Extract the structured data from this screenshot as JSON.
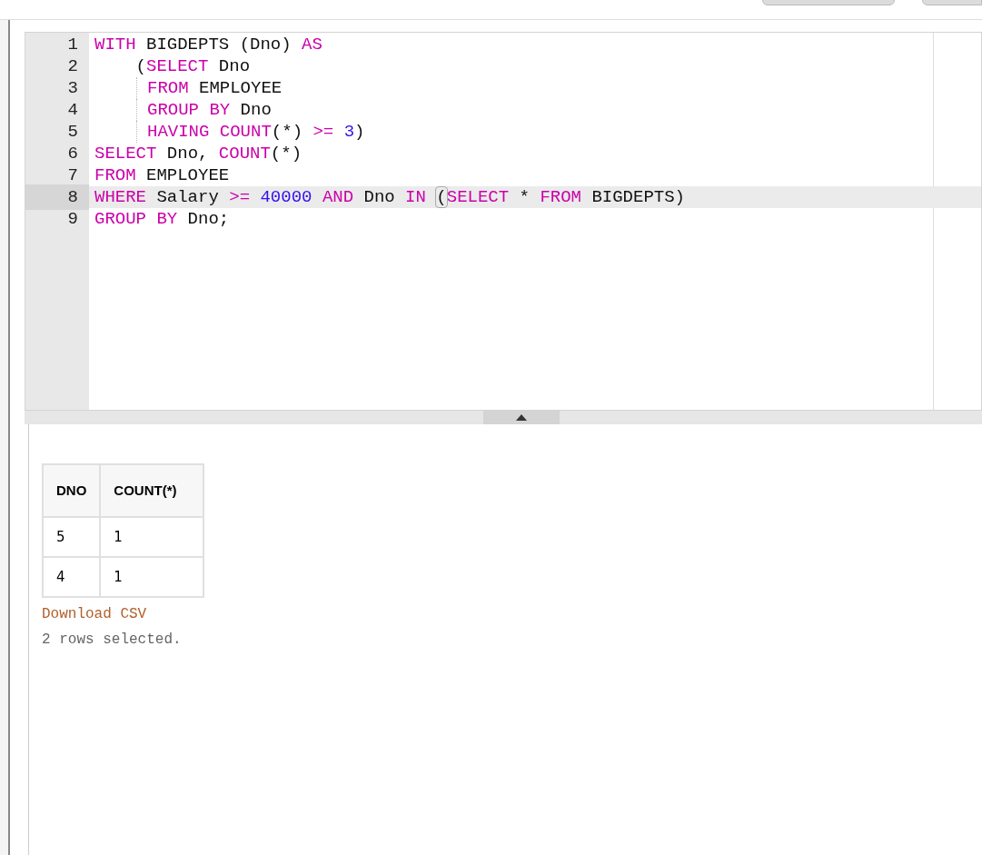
{
  "editor": {
    "lines": [
      {
        "number": "1",
        "active": false,
        "indent_guide": false,
        "tokens": [
          {
            "kind": "keyword",
            "text": "WITH"
          },
          {
            "kind": "plain",
            "text": " BIGDEPTS (Dno) "
          },
          {
            "kind": "keyword",
            "text": "AS"
          }
        ]
      },
      {
        "number": "2",
        "active": false,
        "indent_guide": false,
        "tokens": [
          {
            "kind": "plain",
            "text": "    ("
          },
          {
            "kind": "keyword",
            "text": "SELECT"
          },
          {
            "kind": "plain",
            "text": " Dno"
          }
        ]
      },
      {
        "number": "3",
        "active": false,
        "indent_guide": true,
        "tokens": [
          {
            "kind": "keyword",
            "text": "FROM"
          },
          {
            "kind": "plain",
            "text": " EMPLOYEE"
          }
        ]
      },
      {
        "number": "4",
        "active": false,
        "indent_guide": true,
        "tokens": [
          {
            "kind": "keyword",
            "text": "GROUP BY"
          },
          {
            "kind": "plain",
            "text": " Dno"
          }
        ]
      },
      {
        "number": "5",
        "active": false,
        "indent_guide": true,
        "tokens": [
          {
            "kind": "keyword",
            "text": "HAVING COUNT"
          },
          {
            "kind": "plain",
            "text": "(*) "
          },
          {
            "kind": "keyword",
            "text": ">= "
          },
          {
            "kind": "number",
            "text": "3"
          },
          {
            "kind": "plain",
            "text": ")"
          }
        ]
      },
      {
        "number": "6",
        "active": false,
        "indent_guide": false,
        "tokens": [
          {
            "kind": "keyword",
            "text": "SELECT"
          },
          {
            "kind": "plain",
            "text": " Dno, "
          },
          {
            "kind": "keyword",
            "text": "COUNT"
          },
          {
            "kind": "plain",
            "text": "(*)"
          }
        ]
      },
      {
        "number": "7",
        "active": false,
        "indent_guide": false,
        "tokens": [
          {
            "kind": "keyword",
            "text": "FROM"
          },
          {
            "kind": "plain",
            "text": " EMPLOYEE"
          }
        ]
      },
      {
        "number": "8",
        "active": true,
        "indent_guide": false,
        "tokens": [
          {
            "kind": "keyword",
            "text": "WHERE"
          },
          {
            "kind": "plain",
            "text": " Salary "
          },
          {
            "kind": "keyword",
            "text": ">= "
          },
          {
            "kind": "number",
            "text": "40000 "
          },
          {
            "kind": "keyword",
            "text": "AND"
          },
          {
            "kind": "plain",
            "text": " Dno "
          },
          {
            "kind": "keyword",
            "text": "IN "
          },
          {
            "kind": "bracket",
            "text": "("
          },
          {
            "kind": "keyword",
            "text": "SELECT"
          },
          {
            "kind": "plain",
            "text": " * "
          },
          {
            "kind": "keyword",
            "text": "FROM"
          },
          {
            "kind": "plain",
            "text": " BIGDEPTS)"
          }
        ]
      },
      {
        "number": "9",
        "active": false,
        "indent_guide": false,
        "tokens": [
          {
            "kind": "keyword",
            "text": "GROUP BY"
          },
          {
            "kind": "plain",
            "text": " Dno;"
          }
        ]
      }
    ]
  },
  "results": {
    "columns": [
      "DNO",
      "COUNT(*)"
    ],
    "rows": [
      [
        "5",
        "1"
      ],
      [
        "4",
        "1"
      ]
    ],
    "download_link": "Download CSV",
    "status": "2 rows selected."
  }
}
